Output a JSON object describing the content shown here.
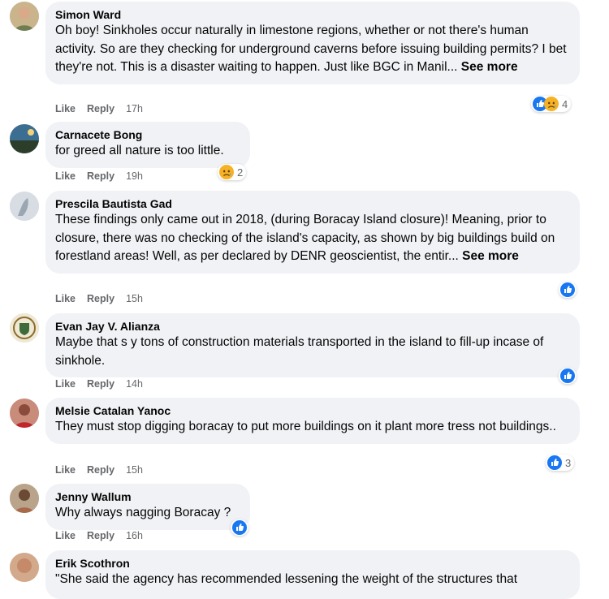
{
  "actions": {
    "like": "Like",
    "reply": "Reply"
  },
  "colors": {
    "like_blue": "#1877f2",
    "sad_yellow": "#f7b125",
    "bubble": "#f0f2f5",
    "meta_gray": "#65676b"
  },
  "comments": [
    {
      "author": "Simon Ward",
      "text": "Oh boy! Sinkholes occur naturally in limestone regions, whether or not there's human activity. So are they checking for underground caverns before issuing building permits? I bet they're not. This is a disaster waiting to happen. Just like BGC in Manil...",
      "see_more": "See more",
      "time": "17h",
      "reactions": [
        "like-icon",
        "sad-icon"
      ],
      "reaction_count": "4"
    },
    {
      "author": "Carnacete Bong",
      "text": "for greed all nature is too little.",
      "time": "19h",
      "reactions": [
        "sad-icon"
      ],
      "reaction_count": "2"
    },
    {
      "author": "Prescila Bautista Gad",
      "text": "These findings only came out in 2018, (during Boracay Island closure)! Meaning, prior to closure, there was no checking of the island's capacity, as shown by big buildings build on forestland areas! Well, as per declared by DENR geoscientist, the entir...",
      "see_more": "See more",
      "time": "15h",
      "reactions": [
        "like-icon"
      ],
      "reaction_count": ""
    },
    {
      "author": "Evan Jay V. Alianza",
      "text": "Maybe that s y tons of construction materials transported in the island to fill-up incase of sinkhole.",
      "time": "14h",
      "reactions": [
        "like-icon"
      ],
      "reaction_count": ""
    },
    {
      "author": "Melsie Catalan Yanoc",
      "text": "They must stop digging boracay to put more buildings on it plant more tress not buildings..",
      "time": "15h",
      "reactions": [
        "like-icon"
      ],
      "reaction_count": "3"
    },
    {
      "author": "Jenny Wallum",
      "text": "Why always nagging Boracay ?",
      "time": "16h",
      "reactions": [
        "like-icon"
      ],
      "reaction_count": ""
    },
    {
      "author": "Erik Scothron",
      "text": "\"She said the agency has recommended lessening the weight of the structures that"
    }
  ]
}
